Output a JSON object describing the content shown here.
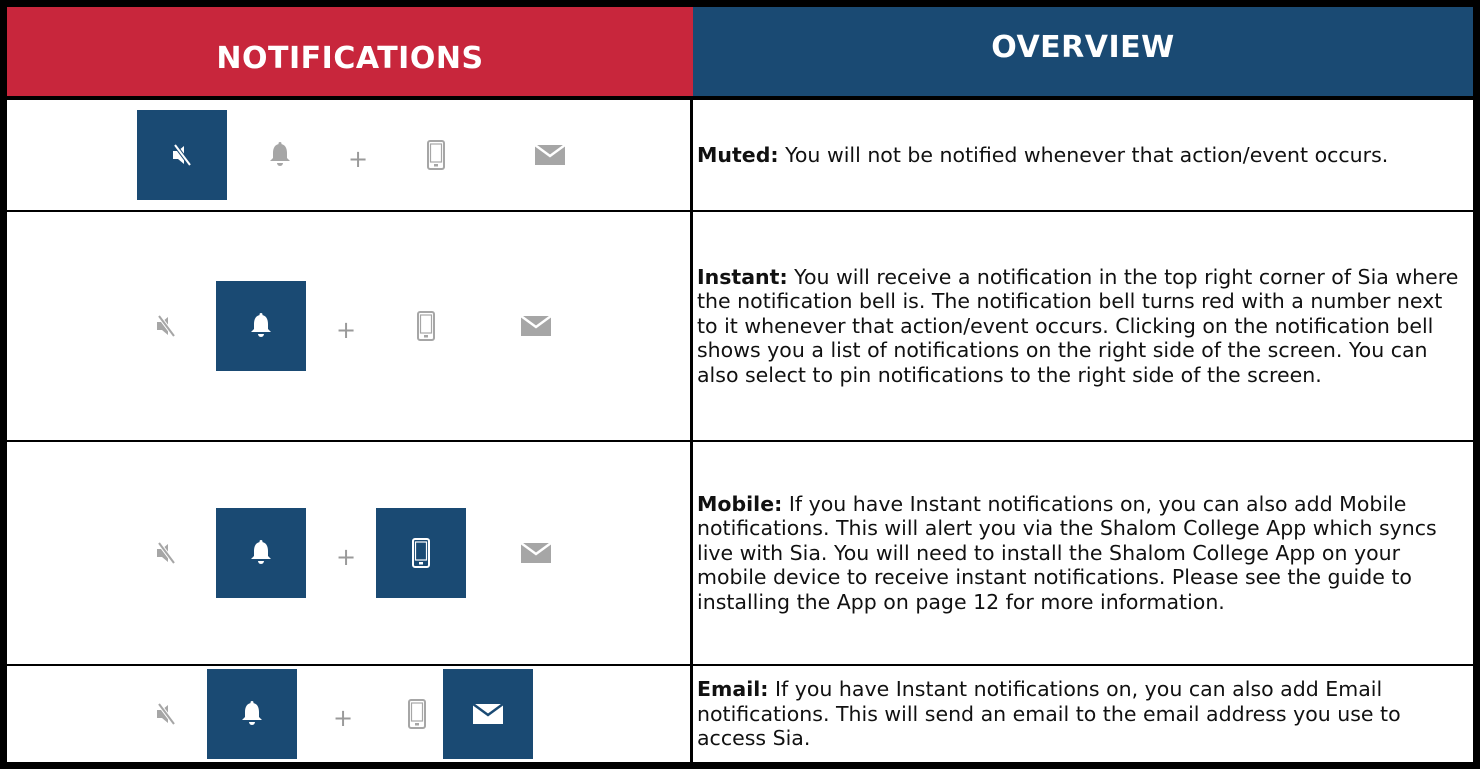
{
  "header": {
    "notifications_label": "NOTIFICATIONS",
    "overview_label": "OVERVIEW"
  },
  "colors": {
    "notifications_header": "#c8263c",
    "overview_header": "#1a4a73",
    "active_icon_bg": "#1a4a73",
    "inactive_icon": "#a6a6a6"
  },
  "rows": [
    {
      "active": [
        "mute"
      ],
      "title": "Muted:",
      "body": " You will not be notified whenever that action/event occurs."
    },
    {
      "active": [
        "bell"
      ],
      "title": "Instant:",
      "body": " You will receive a notification in the top right corner of Sia where the notification bell is. The notification bell turns red with a number next to it whenever that action/event occurs. Clicking on the notification bell shows you a list of notifications on the right side of the screen. You can also select to pin notifications to the right side of the screen."
    },
    {
      "active": [
        "bell",
        "mobile"
      ],
      "title": "Mobile:",
      "body": " If you have Instant notifications on, you can also add Mobile notifications. This will alert you via the Shalom College App which syncs live with Sia. You will need to install the Shalom College App on your mobile device to receive instant notifications. Please see the guide to installing the App on page 12 for more information."
    },
    {
      "active": [
        "bell",
        "email"
      ],
      "title": "Email:",
      "body": " If you have Instant notifications on, you can also add Email notifications. This will send an email to the email address you use to access Sia."
    }
  ],
  "icons": {
    "mute": "muted-speaker-icon",
    "bell": "bell-icon",
    "plus": "+",
    "mobile": "mobile-phone-icon",
    "email": "envelope-icon"
  }
}
